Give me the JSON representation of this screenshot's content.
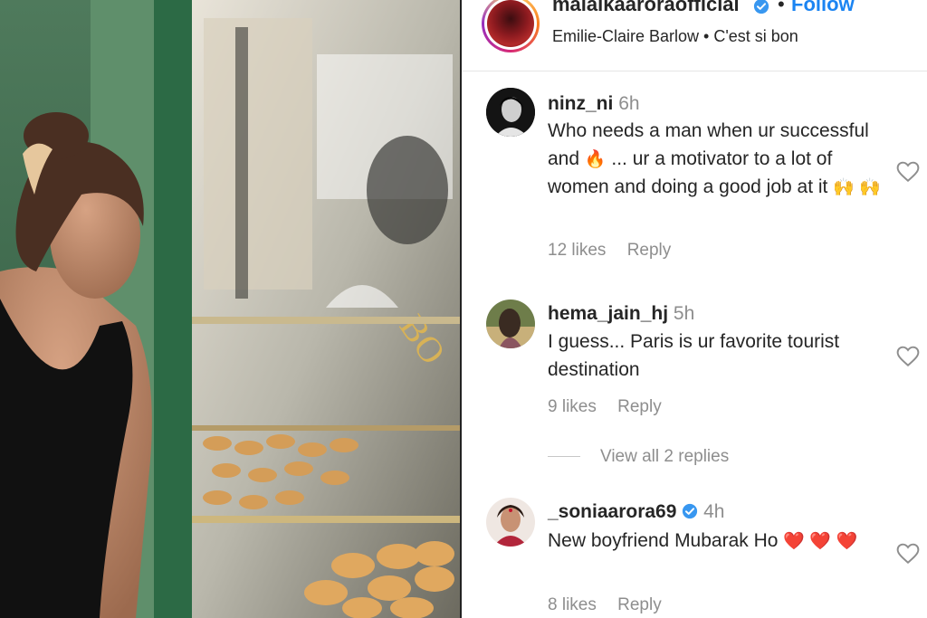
{
  "post": {
    "username": "malaikaaroraofficial",
    "follow_label": "Follow",
    "separator": "•",
    "audio": "Emilie-Claire Barlow • C'est si bon"
  },
  "comments": [
    {
      "username": "ninz_ni",
      "time": "6h",
      "text_parts": [
        "Who needs a man when ur successful and ",
        "🔥",
        " ... ur a motivator to a lot of women and doing a good job at it ",
        "🙌 🙌"
      ],
      "likes": "12 likes",
      "reply_label": "Reply"
    },
    {
      "username": "hema_jain_hj",
      "time": "5h",
      "text": "I guess... Paris is ur favorite tourist destination",
      "likes": "9 likes",
      "reply_label": "Reply"
    },
    {
      "username": "_soniaarora69",
      "time": "4h",
      "text_parts": [
        "New boyfriend Mubarak Ho ",
        "❤️ ❤️",
        " ",
        "❤️"
      ],
      "likes": "8 likes",
      "reply_label": "Reply"
    }
  ],
  "view_replies": "View all 2 replies",
  "colors": {
    "follow_blue": "#1b84f2",
    "verified_blue": "#3897f0",
    "heart_red": "#ed4956",
    "muted_text": "#8e8e8e"
  },
  "icons": [
    "verified-badge-icon",
    "heart-outline-icon",
    "fire-emoji-icon",
    "raised-hands-emoji-icon",
    "red-heart-emoji-icon"
  ]
}
